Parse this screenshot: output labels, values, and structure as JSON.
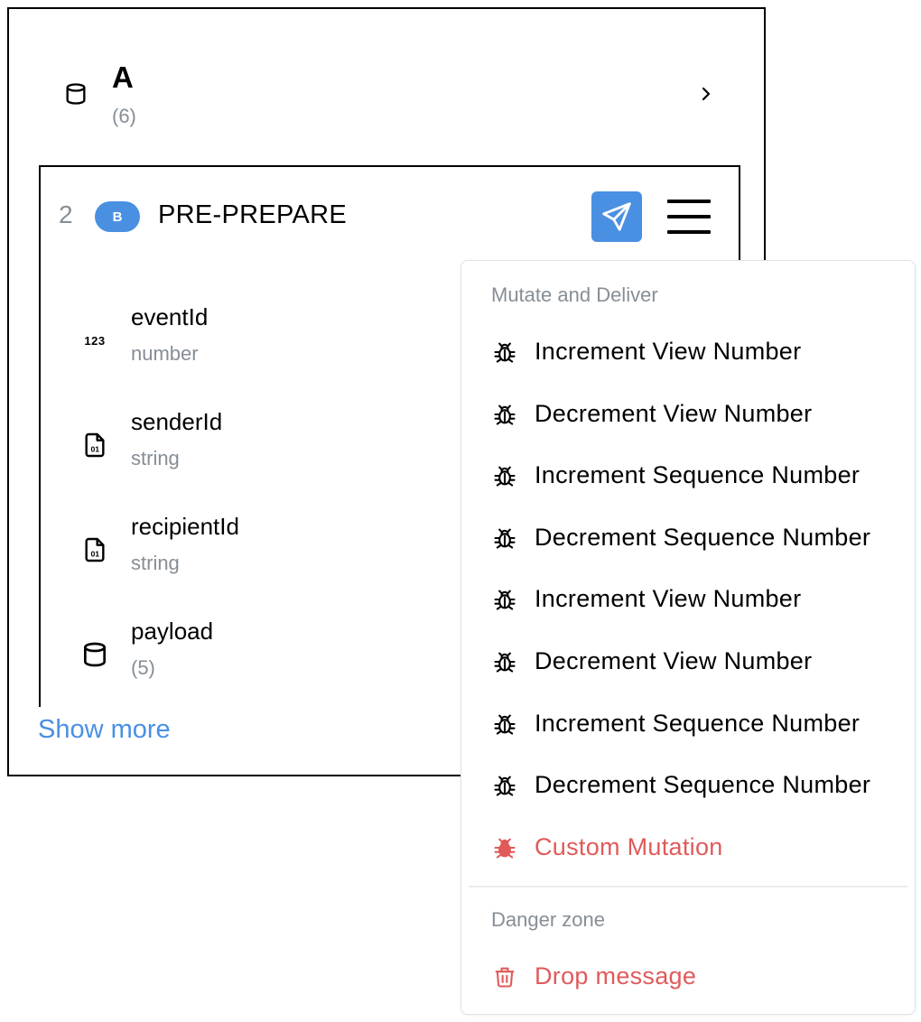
{
  "node": {
    "title": "A",
    "count": "(6)",
    "icon": "database-icon"
  },
  "message": {
    "index": "2",
    "badge": "B",
    "type": "PRE-PREPARE",
    "accent": "#4a90e2",
    "fields": [
      {
        "name": "eventId",
        "type": "number",
        "icon": "numeric-123-icon"
      },
      {
        "name": "senderId",
        "type": "string",
        "icon": "binary-file-icon"
      },
      {
        "name": "recipientId",
        "type": "string",
        "icon": "binary-file-icon"
      },
      {
        "name": "payload",
        "type": "(5)",
        "icon": "database-icon"
      }
    ],
    "show_more": "Show more"
  },
  "menu": {
    "section_label": "Mutate and Deliver",
    "items": [
      {
        "label": "Increment View Number",
        "icon": "bug-outline-icon"
      },
      {
        "label": "Decrement View Number",
        "icon": "bug-outline-icon"
      },
      {
        "label": "Increment Sequence Number",
        "icon": "bug-outline-icon"
      },
      {
        "label": "Decrement Sequence Number",
        "icon": "bug-outline-icon"
      },
      {
        "label": "Increment View Number",
        "icon": "bug-outline-icon"
      },
      {
        "label": "Decrement View Number",
        "icon": "bug-outline-icon"
      },
      {
        "label": "Increment Sequence Number",
        "icon": "bug-outline-icon"
      },
      {
        "label": "Decrement Sequence Number",
        "icon": "bug-outline-icon"
      }
    ],
    "custom": {
      "label": "Custom Mutation",
      "icon": "bug-filled-icon"
    },
    "danger_label": "Danger zone",
    "drop": {
      "label": "Drop message",
      "icon": "trash-icon"
    },
    "danger_color": "#e05a5a"
  }
}
